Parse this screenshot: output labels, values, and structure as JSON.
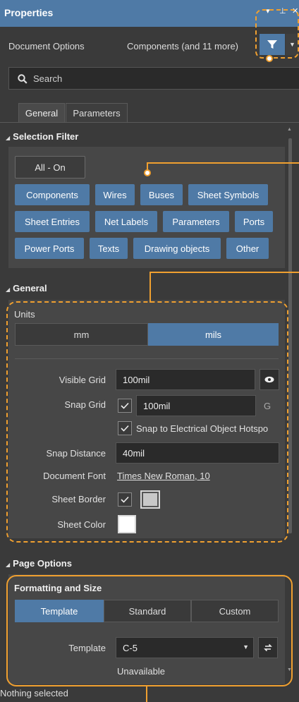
{
  "titlebar": {
    "title": "Properties",
    "menu_glyph": "▾",
    "pin_glyph": "⊥",
    "close_glyph": "✕"
  },
  "doc_row": {
    "document_options": "Document Options",
    "components_summary": "Components (and 11 more)"
  },
  "search": {
    "placeholder": "Search"
  },
  "tabs": [
    {
      "label": "General"
    },
    {
      "label": "Parameters"
    }
  ],
  "selection_filter": {
    "header": "Selection Filter",
    "all_on": "All - On",
    "chips": [
      "Components",
      "Wires",
      "Buses",
      "Sheet Symbols",
      "Sheet Entries",
      "Net Labels",
      "Parameters",
      "Ports",
      "Power Ports",
      "Texts",
      "Drawing objects",
      "Other"
    ]
  },
  "general": {
    "header": "General",
    "units_label": "Units",
    "unit_mm": "mm",
    "unit_mils": "mils",
    "visible_grid_label": "Visible Grid",
    "visible_grid_value": "100mil",
    "snap_grid_label": "Snap Grid",
    "snap_grid_value": "100mil",
    "snap_grid_hotkey": "G",
    "snap_electrical_label": "Snap to Electrical Object Hotspo",
    "snap_distance_label": "Snap Distance",
    "snap_distance_value": "40mil",
    "document_font_label": "Document Font",
    "document_font_value": "Times New Roman, 10",
    "sheet_border_label": "Sheet Border",
    "sheet_color_label": "Sheet Color"
  },
  "page_options": {
    "header": "Page Options",
    "formatting_header": "Formatting and Size",
    "seg_template": "Template",
    "seg_standard": "Standard",
    "seg_custom": "Custom",
    "template_label": "Template",
    "template_value": "C-5",
    "unavailable": "Unavailable"
  },
  "status": {
    "text": "Nothing selected"
  },
  "colors": {
    "accent": "#4f7aa6",
    "callout": "#f0a030",
    "panel": "#474747",
    "background": "#3a3a3a"
  }
}
